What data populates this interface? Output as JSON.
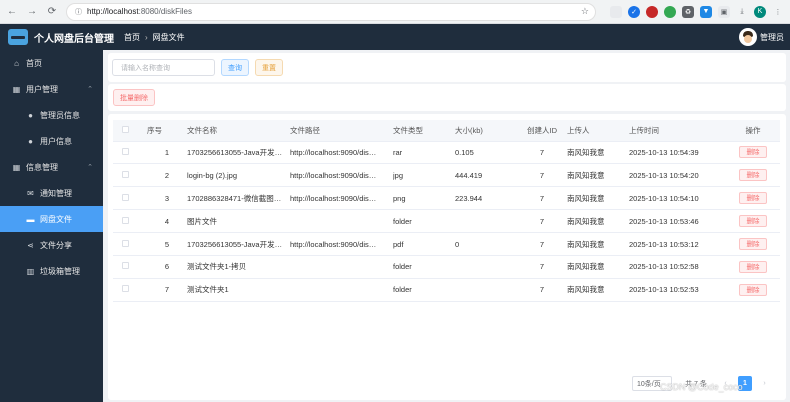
{
  "browser": {
    "url_host": "http://localhost",
    "url_path": ":8080/diskFiles"
  },
  "header": {
    "title": "个人网盘后台管理",
    "breadcrumb": [
      "首页",
      "网盘文件"
    ],
    "user_name": "管理员"
  },
  "sidebar": {
    "items": [
      {
        "label": "首页",
        "icon": "home-icon"
      },
      {
        "label": "用户管理",
        "icon": "grid-icon"
      },
      {
        "label": "管理员信息",
        "icon": "user-icon"
      },
      {
        "label": "用户信息",
        "icon": "user-icon"
      },
      {
        "label": "信息管理",
        "icon": "grid-icon"
      },
      {
        "label": "通知管理",
        "icon": "mail-icon"
      },
      {
        "label": "网盘文件",
        "icon": "folder-icon"
      },
      {
        "label": "文件分享",
        "icon": "share-icon"
      },
      {
        "label": "垃圾箱管理",
        "icon": "trash-icon"
      }
    ],
    "active": "网盘文件"
  },
  "search": {
    "placeholder": "请输入名称查询",
    "query_label": "查询",
    "reset_label": "重置"
  },
  "toolbar": {
    "batch_delete_label": "批量删除"
  },
  "table": {
    "columns": [
      "序号",
      "文件名称",
      "文件路径",
      "文件类型",
      "大小(kb)",
      "创建人ID",
      "上传人",
      "上传时间",
      "操作"
    ],
    "rows": [
      {
        "no": "1",
        "name": "1703256613055-Java开发…",
        "path": "http://localhost:9090/dis…",
        "type": "rar",
        "size": "0.105",
        "creator": "7",
        "uploader": "南风知我意",
        "time": "2025-10-13 10:54:39"
      },
      {
        "no": "2",
        "name": "login-bg (2).jpg",
        "path": "http://localhost:9090/dis…",
        "type": "jpg",
        "size": "444.419",
        "creator": "7",
        "uploader": "南风知我意",
        "time": "2025-10-13 10:54:20"
      },
      {
        "no": "3",
        "name": "1702886328471-微信截图…",
        "path": "http://localhost:9090/dis…",
        "type": "png",
        "size": "223.944",
        "creator": "7",
        "uploader": "南风知我意",
        "time": "2025-10-13 10:54:10"
      },
      {
        "no": "4",
        "name": "图片文件",
        "path": "",
        "type": "folder",
        "size": "",
        "creator": "7",
        "uploader": "南风知我意",
        "time": "2025-10-13 10:53:46"
      },
      {
        "no": "5",
        "name": "1703256613055-Java开发…",
        "path": "http://localhost:9090/dis…",
        "type": "pdf",
        "size": "0",
        "creator": "7",
        "uploader": "南风知我意",
        "time": "2025-10-13 10:53:12"
      },
      {
        "no": "6",
        "name": "测试文件夹1-拷贝",
        "path": "",
        "type": "folder",
        "size": "",
        "creator": "7",
        "uploader": "南风知我意",
        "time": "2025-10-13 10:52:58"
      },
      {
        "no": "7",
        "name": "测试文件夹1",
        "path": "",
        "type": "folder",
        "size": "",
        "creator": "7",
        "uploader": "南风知我意",
        "time": "2025-10-13 10:52:53"
      }
    ],
    "delete_label": "删除"
  },
  "pagination": {
    "page_size": "10条/页",
    "total": "共 7 条",
    "current_page": "1"
  },
  "watermark": "CSDN @Code_coco",
  "colors": {
    "sidebar_bg": "#1f2d3d",
    "active_menu": "#4a9ff5",
    "danger": "#f56c6c",
    "primary": "#409eff"
  }
}
